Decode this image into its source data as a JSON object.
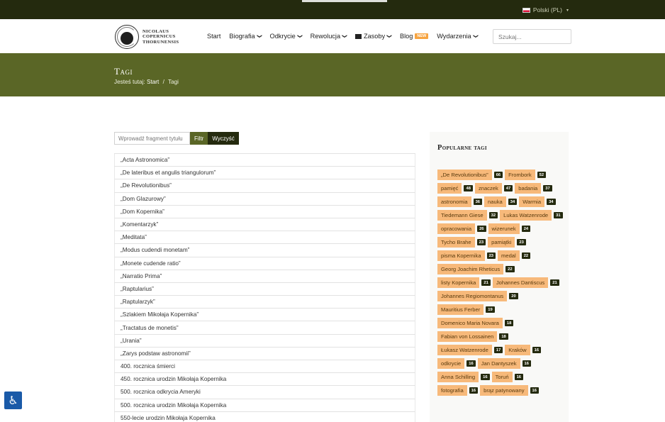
{
  "topbar": {
    "language": "Polski (PL)",
    "caret": "▾"
  },
  "logo": {
    "line1": "NICOLAUS",
    "line2": "COPERNICUS",
    "line3": "THORUNENSIS"
  },
  "nav": {
    "items": [
      {
        "label": "Start",
        "dropdown": false
      },
      {
        "label": "Biografia",
        "dropdown": true
      },
      {
        "label": "Odkrycie",
        "dropdown": true
      },
      {
        "label": "Rewolucja",
        "dropdown": true
      },
      {
        "label": "Zasoby",
        "dropdown": true,
        "icon": "box-icon"
      },
      {
        "label": "Blog",
        "dropdown": false,
        "badge": "NEW"
      },
      {
        "label": "Wydarzenia",
        "dropdown": true
      }
    ],
    "search_placeholder": "Szukaj..."
  },
  "hero": {
    "title": "Tagi",
    "breadcrumb_prefix": "Jesteś tutaj:",
    "breadcrumb_home": "Start",
    "breadcrumb_sep": "/",
    "breadcrumb_current": "Tagi"
  },
  "filter": {
    "placeholder": "Wprowadź fragment tytułu",
    "filter_label": "Filtr",
    "clear_label": "Wyczyść"
  },
  "tags": [
    "„Acta Astronomica”",
    "„De lateribus et angulis triangulorum”",
    "„De Revolutionibus”",
    "„Dom Glazurowy”",
    "„Dom Kopernika”",
    "„Komentarzyk”",
    "„Meditata”",
    "„Modus cudendi monetam”",
    "„Monete cudende ratio”",
    "„Narratio Prima”",
    "„Raptularius”",
    "„Raptularzyk”",
    "„Szlakiem Mikołaja Kopernika”",
    "„Tractatus de monetis”",
    "„Urania”",
    "„Zarys podstaw astronomii”",
    "400. rocznica śmierci",
    "450. rocznica urodzin Mikołaja Kopernika",
    "500. rocznica odkrycia Ameryki",
    "500. rocznica urodzin Mikołaja Kopernika",
    "550-lecie urodzin Mikołaja Kopernika"
  ],
  "sidebar": {
    "title": "Popularne tagi",
    "popular": [
      {
        "name": "„De Revolutionibus”",
        "count": "66"
      },
      {
        "name": "Frombork",
        "count": "52"
      },
      {
        "name": "pamięć",
        "count": "48"
      },
      {
        "name": "znaczek",
        "count": "47"
      },
      {
        "name": "badania",
        "count": "37"
      },
      {
        "name": "astronomia",
        "count": "36"
      },
      {
        "name": "nauka",
        "count": "34"
      },
      {
        "name": "Warmia",
        "count": "34"
      },
      {
        "name": "Tiedemann Giese",
        "count": "32"
      },
      {
        "name": "Lukas Watzenrode",
        "count": "31"
      },
      {
        "name": "opracowania",
        "count": "26"
      },
      {
        "name": "wizerunek",
        "count": "24"
      },
      {
        "name": "Tycho Brahe",
        "count": "23"
      },
      {
        "name": "pamiątki",
        "count": "23"
      },
      {
        "name": "pisma Kopernika",
        "count": "23"
      },
      {
        "name": "medal",
        "count": "22"
      },
      {
        "name": "Georg Joachim Rheticus",
        "count": "22"
      },
      {
        "name": "listy Kopernika",
        "count": "21"
      },
      {
        "name": "Johannes Dantiscus",
        "count": "21"
      },
      {
        "name": "Johannes Regiomontanus",
        "count": "20"
      },
      {
        "name": "Mauritius Ferber",
        "count": "19"
      },
      {
        "name": "Domenico Maria Novara",
        "count": "18"
      },
      {
        "name": "Fabian von Lossainen",
        "count": "18"
      },
      {
        "name": "Łukasz Watzenrode",
        "count": "17"
      },
      {
        "name": "Kraków",
        "count": "16"
      },
      {
        "name": "odkrycie",
        "count": "16"
      },
      {
        "name": "Jan Dantyszek",
        "count": "16"
      },
      {
        "name": "Anna Schilling",
        "count": "16"
      },
      {
        "name": "Toruń",
        "count": "16"
      },
      {
        "name": "fotografia",
        "count": "16"
      },
      {
        "name": "brąz patynowany",
        "count": "16"
      }
    ]
  },
  "accessibility": {
    "icon": "♿"
  },
  "colors": {
    "topbar": "#242a0e",
    "hero": "#5a6626",
    "chip": "#f7b97a",
    "count_badge": "#242a0e",
    "a11y": "#1a5aa8"
  }
}
